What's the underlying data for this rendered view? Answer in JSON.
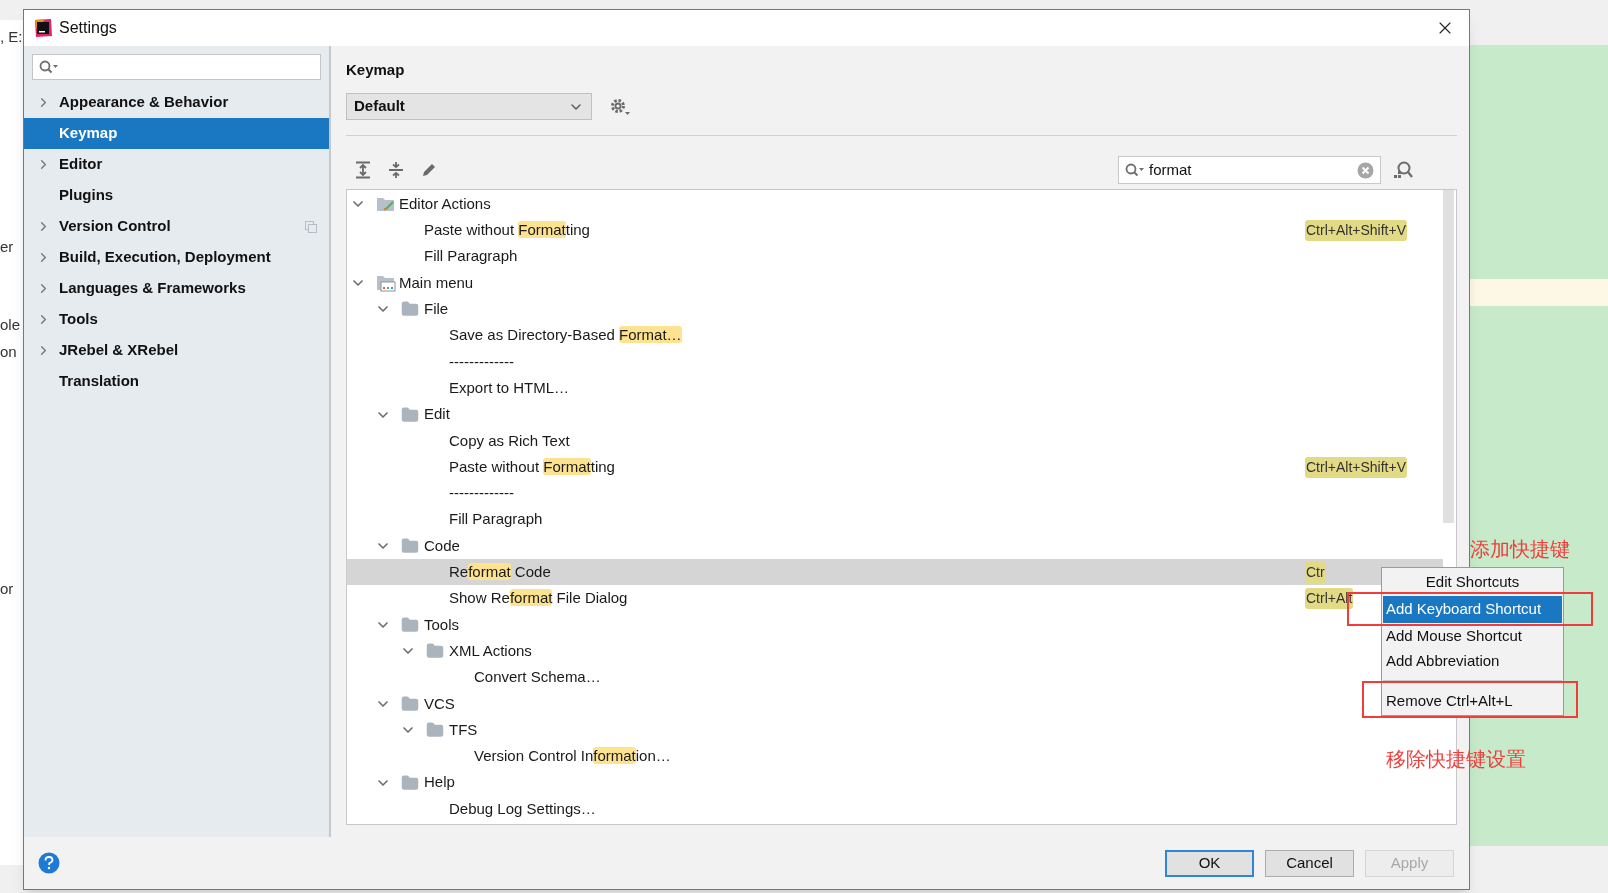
{
  "background": {
    "fragments": [
      ", E:",
      "er",
      "ole",
      "on",
      "or"
    ]
  },
  "window": {
    "title": "Settings"
  },
  "sidebar": {
    "items": [
      {
        "label": "Appearance & Behavior",
        "expandable": true,
        "selected": false,
        "project_icon": false
      },
      {
        "label": "Keymap",
        "expandable": false,
        "selected": true,
        "project_icon": false
      },
      {
        "label": "Editor",
        "expandable": true,
        "selected": false,
        "project_icon": false
      },
      {
        "label": "Plugins",
        "expandable": false,
        "selected": false,
        "project_icon": false
      },
      {
        "label": "Version Control",
        "expandable": true,
        "selected": false,
        "project_icon": true
      },
      {
        "label": "Build, Execution, Deployment",
        "expandable": true,
        "selected": false,
        "project_icon": false
      },
      {
        "label": "Languages & Frameworks",
        "expandable": true,
        "selected": false,
        "project_icon": false
      },
      {
        "label": "Tools",
        "expandable": true,
        "selected": false,
        "project_icon": false
      },
      {
        "label": "JRebel & XRebel",
        "expandable": true,
        "selected": false,
        "project_icon": false
      },
      {
        "label": "Translation",
        "expandable": false,
        "selected": false,
        "project_icon": false
      }
    ]
  },
  "keymap": {
    "title": "Keymap",
    "scheme": "Default",
    "filter": "format"
  },
  "tree": [
    {
      "kind": "actions",
      "expanded": true,
      "selected": false,
      "label": [
        {
          "text": "Editor Actions",
          "match": false
        }
      ],
      "children": [
        {
          "selected": false,
          "label": [
            {
              "text": "Paste without ",
              "match": false
            },
            {
              "text": "Format",
              "match": true
            },
            {
              "text": "ting",
              "match": false
            }
          ],
          "shortcut": "Ctrl+Alt+Shift+V"
        },
        {
          "selected": false,
          "label": [
            {
              "text": "Fill Paragraph",
              "match": false
            }
          ]
        }
      ]
    },
    {
      "kind": "menu",
      "expanded": true,
      "selected": false,
      "label": [
        {
          "text": "Main menu",
          "match": false
        }
      ],
      "children": [
        {
          "kind": "folder",
          "expanded": true,
          "selected": false,
          "label": [
            {
              "text": "File",
              "match": false
            }
          ],
          "children": [
            {
              "selected": false,
              "label": [
                {
                  "text": "Save as Directory-Based ",
                  "match": false
                },
                {
                  "text": "Format…",
                  "match": true
                }
              ]
            },
            {
              "selected": false,
              "label": [
                {
                  "text": "-------------",
                  "match": false
                }
              ]
            },
            {
              "selected": false,
              "label": [
                {
                  "text": "Export to HTML…",
                  "match": false
                }
              ]
            }
          ]
        },
        {
          "kind": "folder",
          "expanded": true,
          "selected": false,
          "label": [
            {
              "text": "Edit",
              "match": false
            }
          ],
          "children": [
            {
              "selected": false,
              "label": [
                {
                  "text": "Copy as Rich Text",
                  "match": false
                }
              ]
            },
            {
              "selected": false,
              "label": [
                {
                  "text": "Paste without ",
                  "match": false
                },
                {
                  "text": "Format",
                  "match": true
                },
                {
                  "text": "ting",
                  "match": false
                }
              ],
              "shortcut": "Ctrl+Alt+Shift+V"
            },
            {
              "selected": false,
              "label": [
                {
                  "text": "-------------",
                  "match": false
                }
              ]
            },
            {
              "selected": false,
              "label": [
                {
                  "text": "Fill Paragraph",
                  "match": false
                }
              ]
            }
          ]
        },
        {
          "kind": "folder",
          "expanded": true,
          "selected": false,
          "label": [
            {
              "text": "Code",
              "match": false
            }
          ],
          "children": [
            {
              "selected": true,
              "label": [
                {
                  "text": "Re",
                  "match": false
                },
                {
                  "text": "format",
                  "match": true
                },
                {
                  "text": " Code",
                  "match": false
                }
              ],
              "shortcut": "Ctr"
            },
            {
              "selected": false,
              "label": [
                {
                  "text": "Show Re",
                  "match": false
                },
                {
                  "text": "format",
                  "match": true
                },
                {
                  "text": " File Dialog",
                  "match": false
                }
              ],
              "shortcut": "Ctrl+Alt"
            }
          ]
        },
        {
          "kind": "folder",
          "expanded": true,
          "selected": false,
          "label": [
            {
              "text": "Tools",
              "match": false
            }
          ],
          "children": [
            {
              "kind": "folder",
              "expanded": true,
              "selected": false,
              "label": [
                {
                  "text": "XML Actions",
                  "match": false
                }
              ],
              "children": [
                {
                  "selected": false,
                  "label": [
                    {
                      "text": "Convert Schema…",
                      "match": false
                    }
                  ]
                }
              ]
            }
          ]
        },
        {
          "kind": "folder",
          "expanded": true,
          "selected": false,
          "label": [
            {
              "text": "VCS",
              "match": false
            }
          ],
          "children": [
            {
              "kind": "folder",
              "expanded": true,
              "selected": false,
              "label": [
                {
                  "text": "TFS",
                  "match": false
                }
              ],
              "children": [
                {
                  "selected": false,
                  "label": [
                    {
                      "text": "Version Control In",
                      "match": false
                    },
                    {
                      "text": "format",
                      "match": true
                    },
                    {
                      "text": "ion…",
                      "match": false
                    }
                  ]
                }
              ]
            }
          ]
        },
        {
          "kind": "folder",
          "expanded": true,
          "selected": false,
          "label": [
            {
              "text": "Help",
              "match": false
            }
          ],
          "children": [
            {
              "selected": false,
              "label": [
                {
                  "text": "Debug Log Settings…",
                  "match": false
                }
              ]
            }
          ]
        }
      ]
    }
  ],
  "context_menu": {
    "title": "Edit Shortcuts",
    "items": [
      {
        "kind": "action",
        "label": "Add Keyboard Shortcut",
        "selected": true
      },
      {
        "kind": "action",
        "label": "Add Mouse Shortcut",
        "selected": false
      },
      {
        "kind": "action",
        "label": "Add Abbreviation",
        "selected": false
      },
      {
        "kind": "separator"
      },
      {
        "kind": "action",
        "label": "Remove Ctrl+Alt+L",
        "selected": false
      }
    ]
  },
  "annotations": [
    {
      "text": "添加快捷键"
    },
    {
      "text": "移除快捷键设置"
    }
  ],
  "buttons": [
    {
      "label": "OK",
      "kind": "primary",
      "disabled": false
    },
    {
      "label": "Cancel",
      "kind": "normal",
      "disabled": false
    },
    {
      "label": "Apply",
      "kind": "normal",
      "disabled": true
    }
  ]
}
